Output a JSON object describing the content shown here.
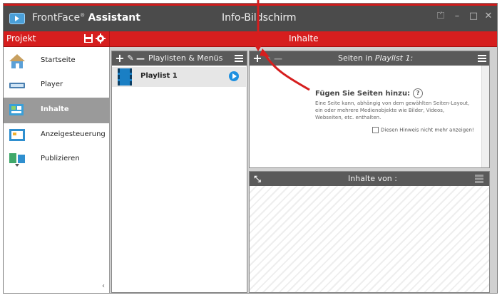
{
  "app": {
    "name_prefix": "FrontFace",
    "name_mark": "®",
    "name_suffix": "Assistant",
    "window_title": "Info-Bildschirm",
    "controls": {
      "pin": "⏍",
      "minimize": "–",
      "maximize": "□",
      "close": "✕"
    }
  },
  "projectbar": {
    "label": "Projekt",
    "content_label": "Inhalte"
  },
  "sidebar": {
    "items": [
      {
        "label": "Startseite",
        "icon": "home-icon",
        "color": "#5aa0d8",
        "active": false
      },
      {
        "label": "Player",
        "icon": "player-icon",
        "color": "#4a7fb0",
        "active": false
      },
      {
        "label": "Inhalte",
        "icon": "content-icon",
        "color": "#3a9fd8",
        "active": true
      },
      {
        "label": "Anzeigesteuerung",
        "icon": "schedule-icon",
        "color": "#2f8fcf",
        "active": false
      },
      {
        "label": "Publizieren",
        "icon": "publish-icon",
        "color": "#3fa86a",
        "active": false
      }
    ],
    "collapse_glyph": "‹"
  },
  "playlists_panel": {
    "title": "Playlisten & Menüs",
    "add": "+",
    "edit": "✎",
    "remove": "—",
    "items": [
      {
        "name": "Playlist 1"
      }
    ]
  },
  "pages_panel": {
    "title_prefix": "Seiten in",
    "title_playlist": "Playlist 1:",
    "add": "+",
    "edit": "✎",
    "remove": "—",
    "hint_title": "Fügen Sie Seiten hinzu:",
    "hint_help": "?",
    "hint_text": "Eine Seite kann, abhängig von dem gewählten Seiten-Layout, ein oder mehrere Medienobjekte wie Bilder, Videos, Webseiten, etc. enthalten.",
    "hint_checkbox": "Diesen Hinweis nicht mehr anzeigen!"
  },
  "contents_panel": {
    "title": "Inhalte von :",
    "expand": "⤡"
  },
  "colors": {
    "accent_red": "#d61e1e",
    "titlebar": "#4b4b4b",
    "panel_header": "#5a5a5a",
    "active_nav": "#9a9a9a"
  }
}
